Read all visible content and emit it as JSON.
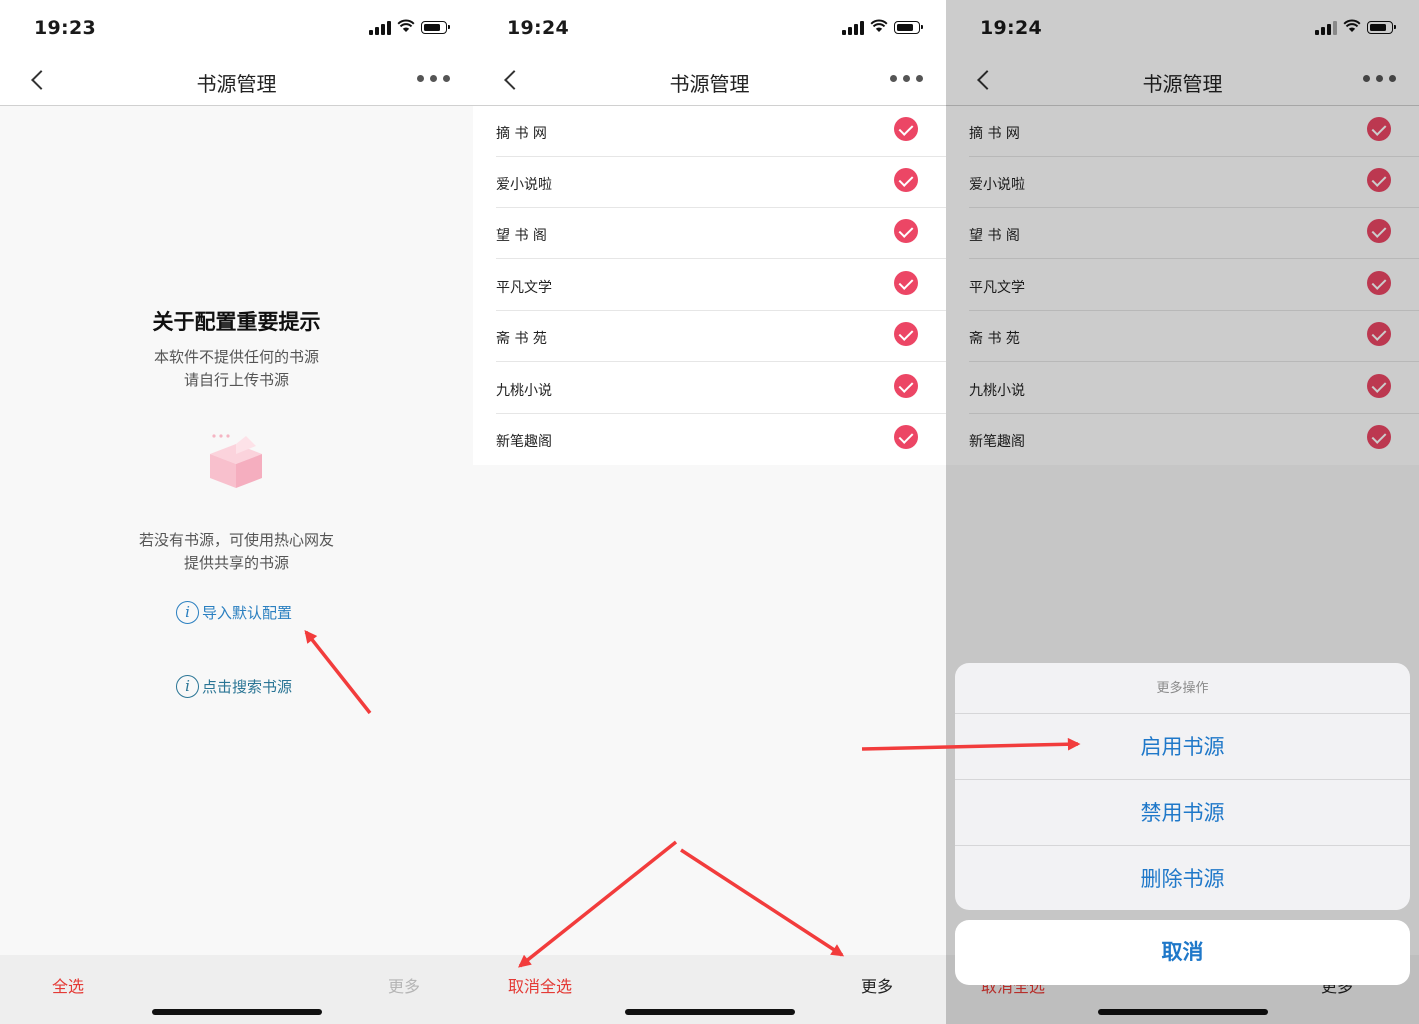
{
  "status_times": [
    "19:23",
    "19:24",
    "19:24"
  ],
  "nav_title": "书源管理",
  "panel1": {
    "notice_title": "关于配置重要提示",
    "notice_lines": [
      "本软件不提供任何的书源",
      "请自行上传书源"
    ],
    "hint_lines": [
      "若没有书源，可使用热心网友",
      "提供共享的书源"
    ],
    "link_import": "导入默认配置",
    "link_search": "点击搜索书源",
    "select_all": "全选",
    "more": "更多"
  },
  "sources": [
    "摘 书 网",
    "爱小说啦",
    "望 书 阁",
    "平凡文学",
    "斋 书 苑",
    "九桃小说",
    "新笔趣阁"
  ],
  "panel2": {
    "deselect_all": "取消全选",
    "more": "更多"
  },
  "action_sheet": {
    "title": "更多操作",
    "enable": "启用书源",
    "disable": "禁用书源",
    "delete": "删除书源",
    "cancel": "取消"
  },
  "colors": {
    "check": "#ec4665",
    "accent_blue": "#1f78c9",
    "select_red": "#e43a35",
    "arrow_red": "#f23c3c"
  },
  "icons": [
    "back-icon",
    "more-dots-icon",
    "signal-icon",
    "wifi-icon",
    "battery-icon",
    "gift-box-icon",
    "info-icon",
    "check-icon"
  ]
}
